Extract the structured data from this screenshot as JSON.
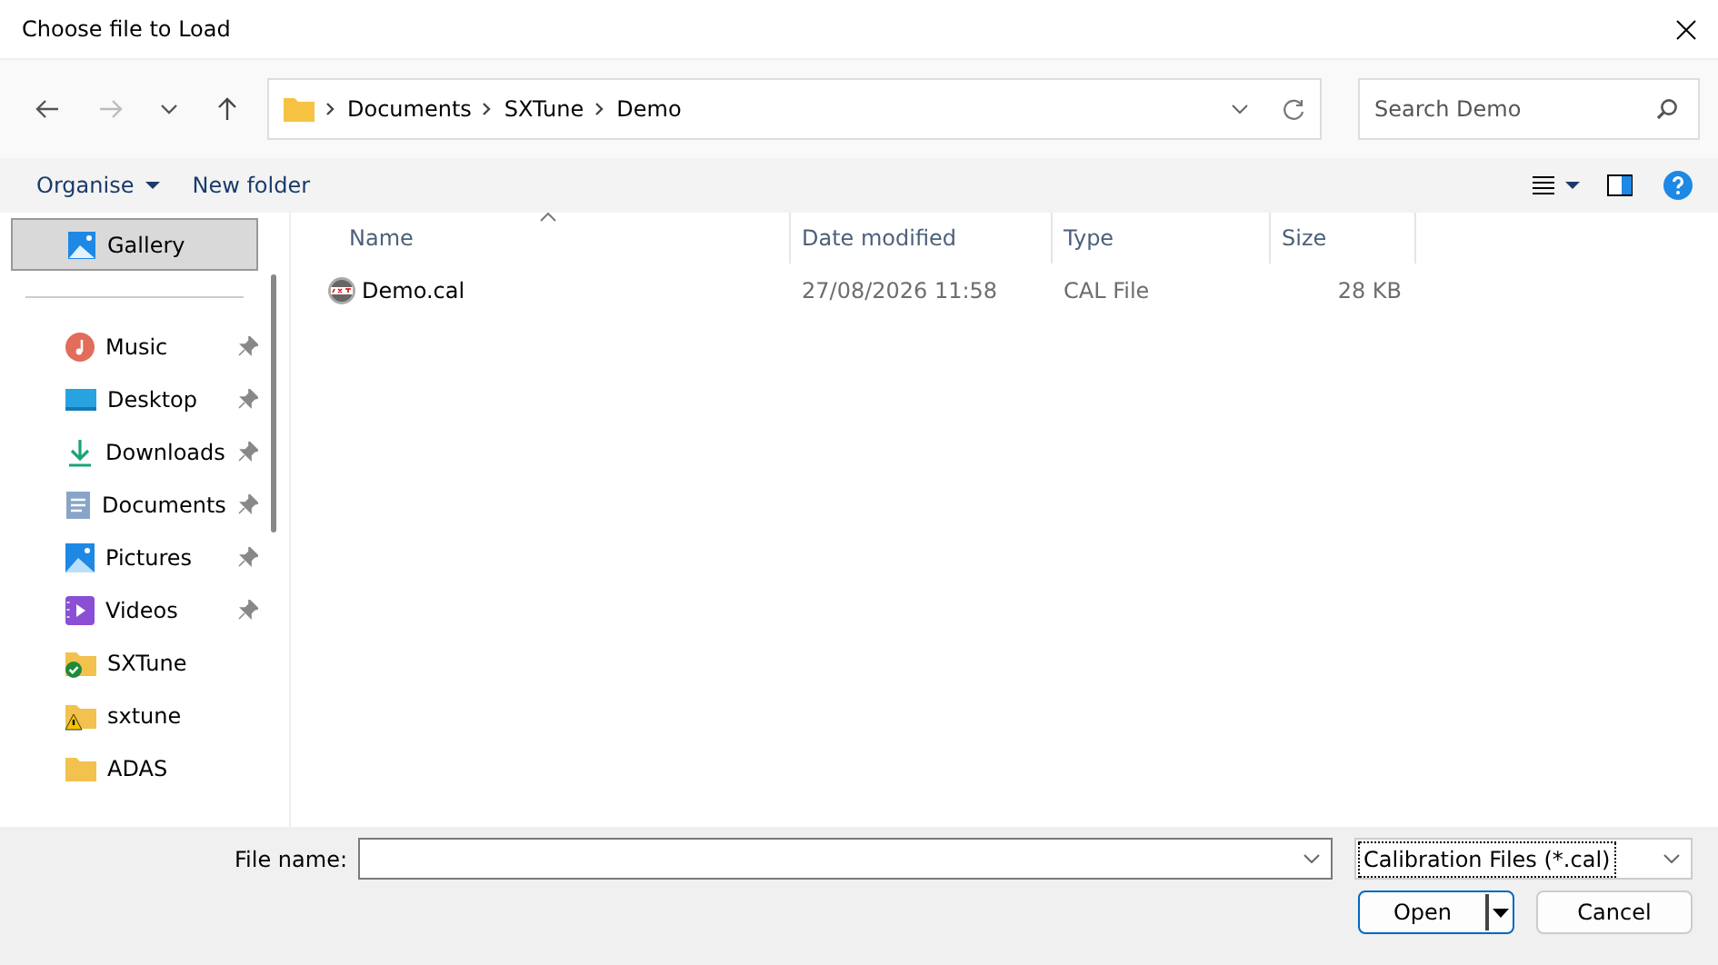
{
  "window": {
    "title": "Choose file to Load"
  },
  "navigation": {
    "back_enabled": true,
    "forward_enabled": false,
    "breadcrumb": [
      "Documents",
      "SXTune",
      "Demo"
    ]
  },
  "search": {
    "placeholder": "Search Demo"
  },
  "toolbar": {
    "organise": "Organise",
    "new_folder": "New folder"
  },
  "sidebar": {
    "top_items": [
      {
        "label": "Gallery",
        "kind": "gallery",
        "selected": true
      }
    ],
    "items": [
      {
        "label": "Music",
        "kind": "music",
        "pinned": true,
        "selected": false
      },
      {
        "label": "Desktop",
        "kind": "desktop",
        "pinned": true,
        "selected": false
      },
      {
        "label": "Downloads",
        "kind": "downloads",
        "pinned": true,
        "selected": false
      },
      {
        "label": "Documents",
        "kind": "documents",
        "pinned": true,
        "selected": false
      },
      {
        "label": "Pictures",
        "kind": "pictures",
        "pinned": true,
        "selected": false
      },
      {
        "label": "Videos",
        "kind": "videos",
        "pinned": true,
        "selected": false
      },
      {
        "label": "SXTune",
        "kind": "folder-ok",
        "pinned": false,
        "selected": false
      },
      {
        "label": "sxtune",
        "kind": "folder-warning",
        "pinned": false,
        "selected": false
      },
      {
        "label": "ADAS",
        "kind": "folder",
        "pinned": false,
        "selected": false
      }
    ]
  },
  "file_list": {
    "columns": [
      {
        "label": "Name",
        "sorted": true
      },
      {
        "label": "Date modified",
        "sorted": false
      },
      {
        "label": "Type",
        "sorted": false
      },
      {
        "label": "Size",
        "sorted": false
      }
    ],
    "rows": [
      {
        "name": "Demo.cal",
        "date_modified": "27/08/2026 11:58",
        "type": "CAL File",
        "size": "28 KB"
      }
    ]
  },
  "footer": {
    "file_name_label": "File name:",
    "file_type": "Calibration Files (*.cal)",
    "buttons": [
      {
        "label": "Open",
        "kind": "split"
      },
      {
        "label": "Cancel",
        "kind": "plain"
      }
    ]
  }
}
